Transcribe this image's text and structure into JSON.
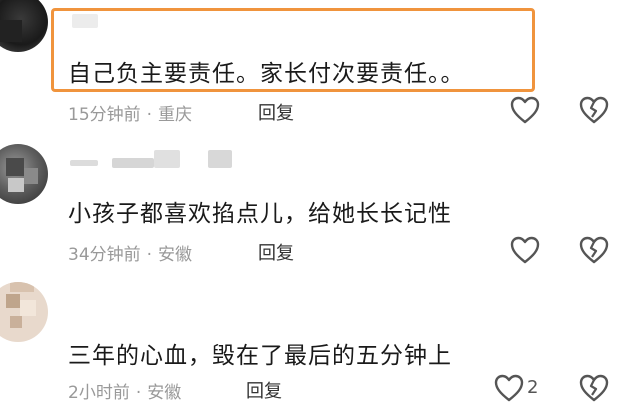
{
  "comments": [
    {
      "text": "自己负主要责任。家长付次要责任。。",
      "time": "15分钟前",
      "location": "重庆",
      "reply_label": "回复",
      "like_count": ""
    },
    {
      "text": "小孩子都喜欢掐点儿，给她长长记性",
      "time": "34分钟前",
      "location": "安徽",
      "reply_label": "回复",
      "like_count": ""
    },
    {
      "text": "三年的心血，毁在了最后的五分钟上",
      "time": "2小时前",
      "location": "安徽",
      "reply_label": "回复",
      "like_count": "2"
    }
  ],
  "separator": "·",
  "colors": {
    "highlight_border": "#f0943d",
    "meta_text": "#999999",
    "body_text": "#1a1a1a"
  },
  "icons": {
    "like": "heart-outline-icon",
    "dislike": "broken-heart-icon"
  }
}
